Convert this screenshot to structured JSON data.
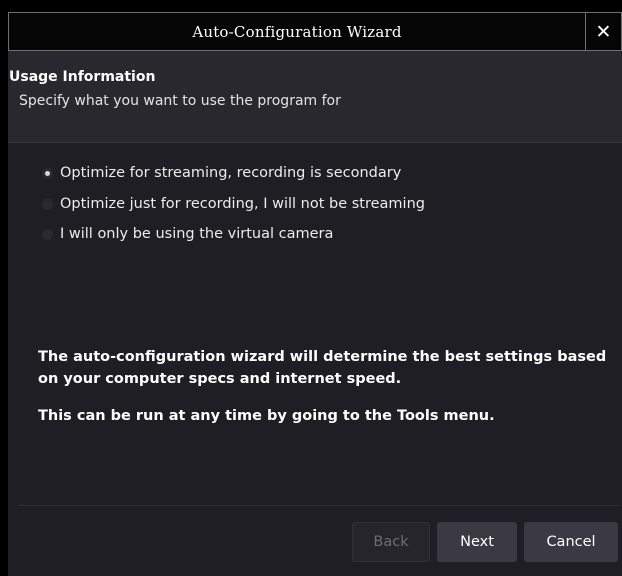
{
  "window": {
    "title": "Auto-Configuration Wizard",
    "close_glyph": "✕"
  },
  "header": {
    "title": "Usage Information",
    "subtitle": "Specify what you want to use the program for"
  },
  "options": [
    {
      "label": "Optimize for streaming, recording is secondary",
      "checked": true
    },
    {
      "label": "Optimize just for recording, I will not be streaming",
      "checked": false
    },
    {
      "label": "I will only be using the virtual camera",
      "checked": false
    }
  ],
  "info": {
    "line1": "The auto-configuration wizard will determine the best settings based",
    "line2": "on your computer specs and internet speed.",
    "line3": "This can be run at any time by going to the Tools menu."
  },
  "buttons": {
    "back": "Back",
    "next": "Next",
    "cancel": "Cancel",
    "back_enabled": false
  }
}
